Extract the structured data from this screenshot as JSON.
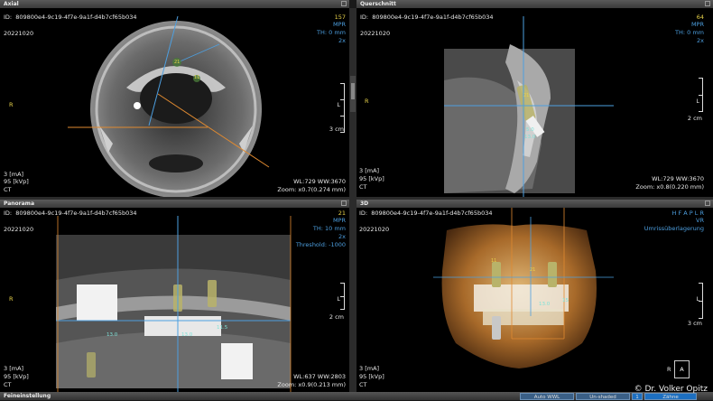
{
  "axial": {
    "title": "Axial",
    "id": "ID:  809800e4-9c19-4f7e-9a1f-d4b7cf65b034",
    "date": "20221020",
    "slice": "157",
    "mode": "MPR",
    "th": "TH: 0 mm",
    "zoom_factor": "2x",
    "side_r": "R",
    "side_l": "L",
    "scale": "3 cm",
    "ma": "3 [mA]",
    "kvp": "95 [kVp]",
    "ct": "CT",
    "wl": "WL:729 WW:3670",
    "zoom": "Zoom: x0.7(0.274 mm)",
    "implant_label_1": "21",
    "implant_label_2": "11"
  },
  "cross": {
    "title": "Querschnitt",
    "id": "ID:  809800e4-9c19-4f7e-9a1f-d4b7cf65b034",
    "date": "20221020",
    "slice": "64",
    "mode": "MPR",
    "th": "TH: 0 mm",
    "zoom_factor": "2x",
    "side_r": "R",
    "side_l": "L",
    "scale": "2 cm",
    "ma": "3 [mA]",
    "kvp": "95 [kVp]",
    "ct": "CT",
    "wl": "WL:729 WW:3670",
    "zoom": "Zoom: x0.8(0.220 mm)",
    "implant_label": "21",
    "implant_size_1": "5.0",
    "implant_size_2": "13.0"
  },
  "panorama": {
    "title": "Panorama",
    "id": "ID:  809800e4-9c19-4f7e-9a1f-d4b7cf65b034",
    "date": "20221020",
    "slice": "21",
    "mode": "MPR",
    "th": "TH: 10 mm",
    "zoom_factor": "2x",
    "threshold": "Threshold: -1000",
    "side_r": "R",
    "side_l": "L",
    "scale": "2 cm",
    "ma": "3 [mA]",
    "kvp": "95 [kVp]",
    "ct": "CT",
    "wl": "WL:637 WW:2803",
    "zoom": "Zoom: x0.9(0.213 mm)",
    "implant_sizes": [
      "13.0",
      "13.0",
      "11.5"
    ]
  },
  "view3d": {
    "title": "3D",
    "id": "ID:  809800e4-9c19-4f7e-9a1f-d4b7cf65b034",
    "date": "20221020",
    "orient": "H F A P L R",
    "mode": "VR",
    "overlay": "Umrissüberlagerung",
    "side_l": "L",
    "scale": "3 cm",
    "ma": "3 [mA]",
    "kvp": "95 [kVp]",
    "ct": "CT",
    "cube_r": "R",
    "cube_a": "A",
    "implant_labels": [
      "11",
      "21",
      "13.0",
      "15"
    ]
  },
  "statusbar": {
    "label": "Feineinstellung",
    "btn_auto": "Auto WWL",
    "btn_unshaded": "Un-shaded",
    "btn_1": "1",
    "btn_zaehne": "Zähne"
  },
  "copyright": "© Dr. Volker Opitz",
  "colors": {
    "accent": "#4d9fe0",
    "bone": "#c8a46a"
  }
}
